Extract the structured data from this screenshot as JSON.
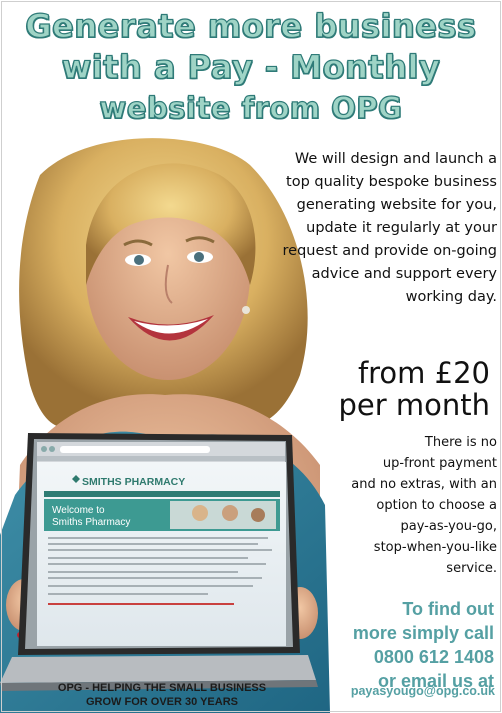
{
  "headline": {
    "line1": "Generate more business",
    "line2": "with a Pay - Monthly",
    "line3": "website from OPG"
  },
  "intro": {
    "lines": [
      "We will design and launch a",
      "top quality bespoke business",
      "generating website for you,",
      "update it regularly at your",
      "request and provide on-going",
      "advice and support every",
      "working day."
    ]
  },
  "price": {
    "line1": "from £20",
    "line2": "per month"
  },
  "terms": {
    "lines": [
      "There is no",
      "up-front payment",
      "and no extras, with an",
      "option to choose a",
      "pay-as-you-go,",
      "stop-when-you-like",
      "service."
    ]
  },
  "cta": {
    "lines": [
      "To find out",
      "more simply call",
      "0800 612 1408",
      "or email us at"
    ],
    "email": "payasyougo@opg.co.uk"
  },
  "footer": {
    "line1": "OPG - HELPING THE SMALL BUSINESS",
    "line2": "GROW FOR OVER 30 YEARS"
  },
  "laptop": {
    "logo_text": "SMITHS PHARMACY",
    "welcome_line1": "Welcome to",
    "welcome_line2": "Smiths Pharmacy"
  },
  "colors": {
    "headline_fill": "#9fd4c6",
    "headline_outline": "#2f7b78",
    "accent_teal": "#55a0a3",
    "top_bg": "#3f8585"
  }
}
